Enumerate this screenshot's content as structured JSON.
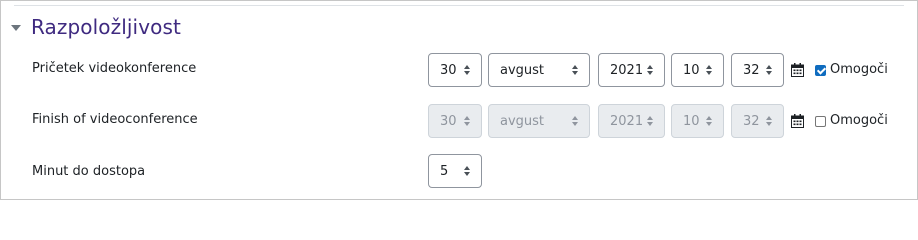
{
  "section": {
    "title": "Razpoložljivost"
  },
  "rows": [
    {
      "label": "Pričetek videokonference",
      "day": "30",
      "month": "avgust",
      "year": "2021",
      "hour": "10",
      "minute": "32",
      "enable_label": "Omogoči",
      "enabled": true
    },
    {
      "label": "Finish of videoconference",
      "day": "30",
      "month": "avgust",
      "year": "2021",
      "hour": "10",
      "minute": "32",
      "enable_label": "Omogoči",
      "enabled": false
    }
  ],
  "access": {
    "label": "Minut do dostopa",
    "value": "5"
  },
  "colors": {
    "title": "#3f2a80",
    "checkbox_checked": "#0f6cbf"
  }
}
